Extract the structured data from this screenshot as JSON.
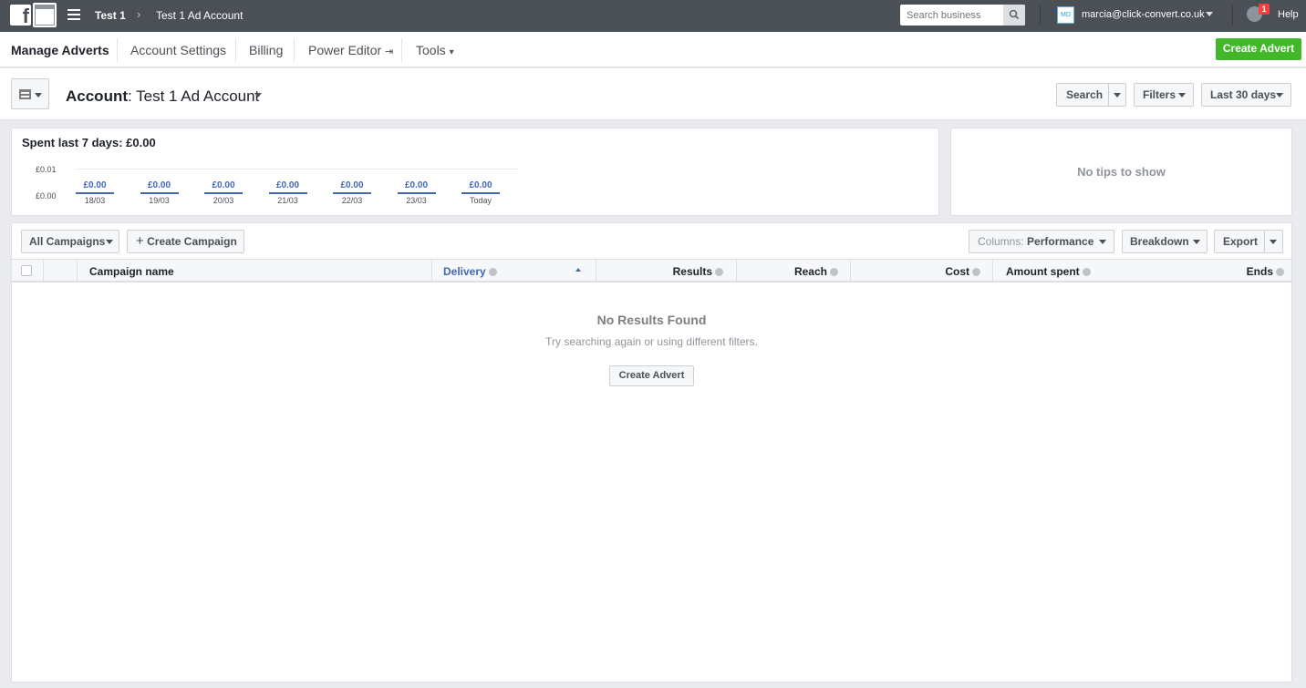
{
  "topbar": {
    "logo": "f",
    "business": "Test 1",
    "separator": "›",
    "account": "Test 1 Ad Account",
    "search_placeholder": "Search business",
    "avatar_initials": "MD",
    "user_email": "marcia@click-convert.co.uk",
    "notification_count": "1",
    "help": "Help"
  },
  "nav": {
    "items": [
      "Manage Adverts",
      "Account Settings",
      "Billing",
      "Power Editor",
      "Tools"
    ],
    "power_editor_icon": "⇥",
    "tools_caret": "▾",
    "create_advert": "Create Advert"
  },
  "account_header": {
    "label": "Account",
    "name": ": Test 1 Ad Account",
    "search": "Search",
    "filters": "Filters",
    "date_range": "Last 30 days"
  },
  "spend": {
    "title": "Spent last 7 days: £0.00",
    "y_top": "£0.01",
    "y_bottom": "£0.00",
    "days": [
      {
        "value": "£0.00",
        "label": "18/03"
      },
      {
        "value": "£0.00",
        "label": "19/03"
      },
      {
        "value": "£0.00",
        "label": "20/03"
      },
      {
        "value": "£0.00",
        "label": "21/03"
      },
      {
        "value": "£0.00",
        "label": "22/03"
      },
      {
        "value": "£0.00",
        "label": "23/03"
      },
      {
        "value": "£0.00",
        "label": "Today"
      }
    ]
  },
  "chart_data": {
    "type": "bar",
    "categories": [
      "18/03",
      "19/03",
      "20/03",
      "21/03",
      "22/03",
      "23/03",
      "Today"
    ],
    "values": [
      0,
      0,
      0,
      0,
      0,
      0,
      0
    ],
    "title": "Spent last 7 days: £0.00",
    "ylim": [
      0,
      0.01
    ]
  },
  "tips": {
    "text": "No tips to show"
  },
  "toolbar": {
    "all_campaigns": "All Campaigns",
    "create_campaign": "Create Campaign",
    "columns_label": "Columns:",
    "columns_value": "Performance",
    "breakdown": "Breakdown",
    "export": "Export"
  },
  "table": {
    "columns": [
      "Campaign name",
      "Delivery",
      "Results",
      "Reach",
      "Cost",
      "Amount spent",
      "Ends"
    ],
    "sorted_column": "Delivery",
    "empty_title": "No Results Found",
    "empty_subtitle": "Try searching again or using different filters.",
    "empty_button": "Create Advert"
  },
  "colors": {
    "topbar": "#4b4f56",
    "accent_blue": "#4267b2",
    "green": "#42b72a",
    "notification": "#fa3e3e"
  }
}
